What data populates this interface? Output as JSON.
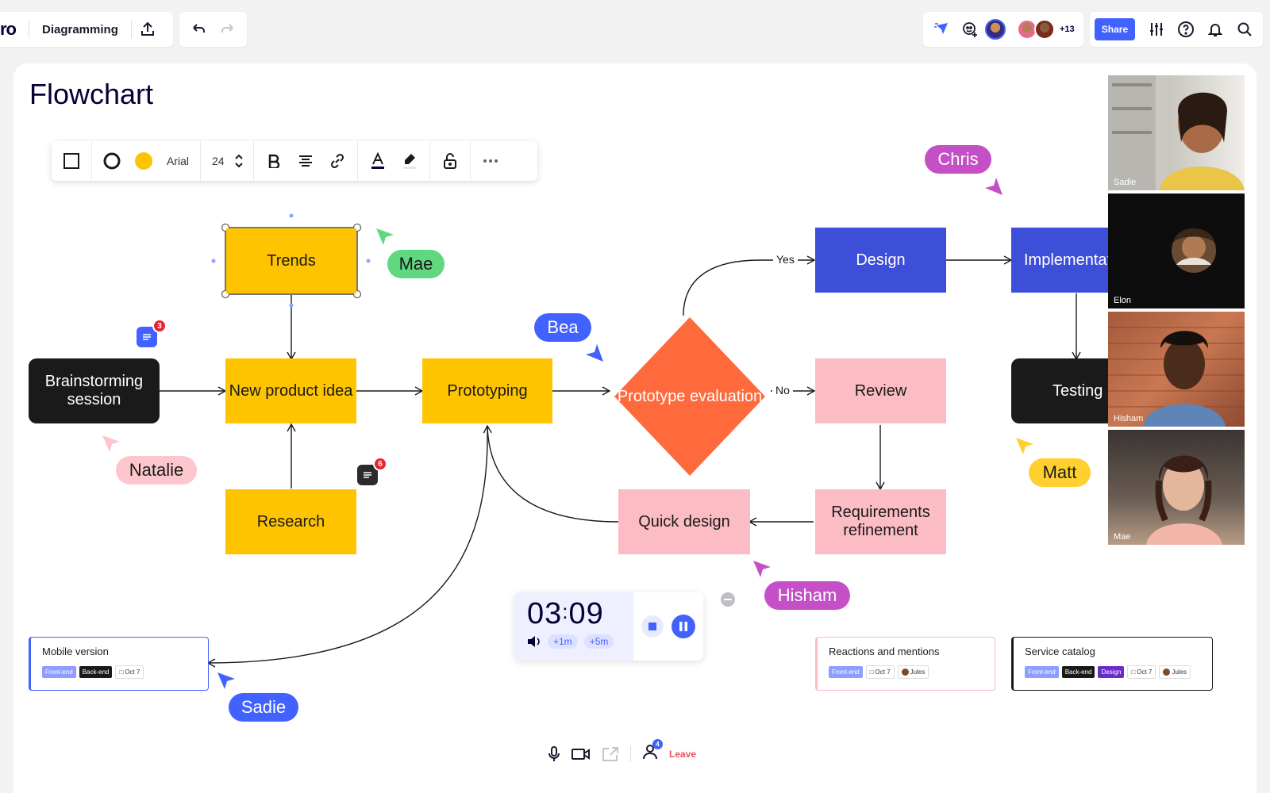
{
  "app": {
    "logo": "ro",
    "board_name": "Diagramming"
  },
  "collab": {
    "extra_count": "+13"
  },
  "header": {
    "share_label": "Share"
  },
  "board": {
    "title": "Flowchart"
  },
  "format_toolbar": {
    "font": "Arial",
    "size": "24",
    "fill_color": "#ffc400"
  },
  "nodes": {
    "trends": "Trends",
    "brainstorming": "Brainstorming session",
    "new_product_idea": "New product idea",
    "prototyping": "Prototyping",
    "research": "Research",
    "prototype_evaluation": "Prototype evaluation",
    "design": "Design",
    "implementation": "Implementat",
    "review": "Review",
    "testing": "Testing",
    "quick_design": "Quick design",
    "requirements": "Requirements refinement"
  },
  "edges": {
    "yes": "Yes",
    "no": "No"
  },
  "cursors": [
    {
      "name": "Mae",
      "color": "#5fd87f",
      "text_color": "#1a1a1a"
    },
    {
      "name": "Chris",
      "color": "#c54fc7",
      "text_color": "#ffffff"
    },
    {
      "name": "Bea",
      "color": "#4262ff",
      "text_color": "#ffffff"
    },
    {
      "name": "Natalie",
      "color": "#fcc6cc",
      "text_color": "#1a1a1a"
    },
    {
      "name": "Matt",
      "color": "#ffd02f",
      "text_color": "#1a1a1a"
    },
    {
      "name": "Hisham",
      "color": "#c54fc7",
      "text_color": "#ffffff"
    },
    {
      "name": "Sadie",
      "color": "#4262ff",
      "text_color": "#ffffff"
    }
  ],
  "comments": [
    {
      "count": "3",
      "color": "#4262ff"
    },
    {
      "count": "6",
      "color": "#2b2b2b"
    }
  ],
  "cards": [
    {
      "title": "Mobile version",
      "tags": [
        "Front-end",
        "Back-end"
      ],
      "date": "Oct 7"
    },
    {
      "title": "Reactions and mentions",
      "tags": [
        "Front-end"
      ],
      "date": "Oct 7",
      "assignee": "Jules"
    },
    {
      "title": "Service catalog",
      "tags": [
        "Front-end",
        "Back-end",
        "Design"
      ],
      "date": "Oct 7",
      "assignee": "Jules"
    }
  ],
  "timer": {
    "minutes": "03",
    "seconds": "09",
    "add_1m": "+1m",
    "add_5m": "+5m"
  },
  "call": {
    "participants_badge": "4",
    "leave_label": "Leave"
  },
  "videos": [
    {
      "name": "Sadie"
    },
    {
      "name": "Elon"
    },
    {
      "name": "Hisham"
    },
    {
      "name": "Mae"
    }
  ],
  "colors": {
    "accent": "#4262ff",
    "yellow": "#ffc400",
    "blue_node": "#3d4fd8",
    "pink_node": "#fcbcc4",
    "orange_diamond": "#ff6a3d",
    "dark_node": "#1a1a1a"
  }
}
